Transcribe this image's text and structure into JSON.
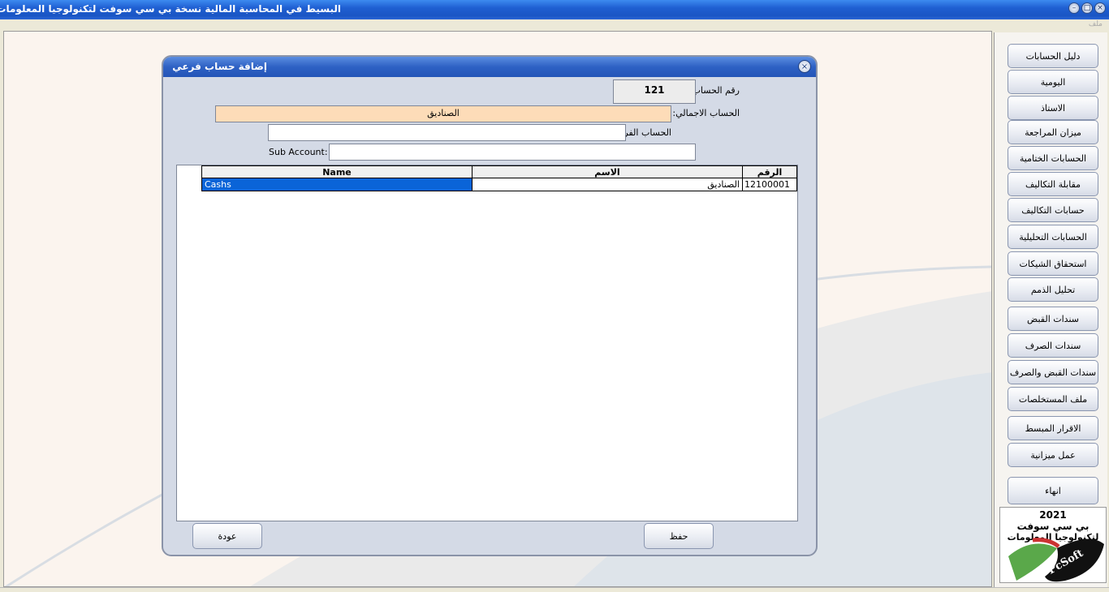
{
  "window": {
    "title": "البسيط في المحاسبة المالية   نسخة بي سي سوفت لتكنولوجيا المعلومات",
    "min_glyph": "–",
    "max_glyph": "□",
    "close_glyph": "×"
  },
  "menu": {
    "file": "ملف"
  },
  "sidebar": {
    "items": [
      "دليل الحسابات",
      "اليومية",
      "الاستاذ",
      "ميزان المراجعة",
      "الحسابات الختامية",
      "مقابلة التكاليف",
      "حسابات التكاليف",
      "الحسابات التحليلية",
      "استحقاق الشيكات",
      "تحليل الذمم",
      "سندات القبض",
      "سندات الصرف",
      "سندات القبض والصرف",
      "ملف المستخلصات",
      "الاقرار المبسط",
      "عمل ميزانية",
      "انهاء"
    ],
    "logo": {
      "year": "2021",
      "line1": "بي سي سوفت",
      "line2": "لتكنولوجيا المعلومات",
      "brand": "PcSoft"
    }
  },
  "dialog": {
    "title": "إضافة حساب فرعي",
    "close_glyph": "×",
    "account_number_label": "رقم الحساب:",
    "account_number_value": "121",
    "parent_account_label": "الحساب الاجمالي:",
    "parent_account_value": "الصناديق",
    "sub_account_label": "الحساب الفرعي:",
    "sub_account_value": "",
    "sub_account_en_label": "Sub Account:",
    "sub_account_en_value": "",
    "grid": {
      "headers": {
        "number": "الرقم",
        "name_ar": "الاسم",
        "name_en": "Name"
      },
      "rows": [
        {
          "number": "12100001",
          "name_ar": "الصناديق",
          "name_en": "Cashs"
        }
      ]
    },
    "save_label": "حفظ",
    "back_label": "عودة"
  },
  "colors": {
    "title_blue": "#1f5fd2",
    "parent_field_bg": "#fddcb8",
    "selected_cell": "#0a64d8",
    "dialog_bg": "#d4dae6"
  }
}
